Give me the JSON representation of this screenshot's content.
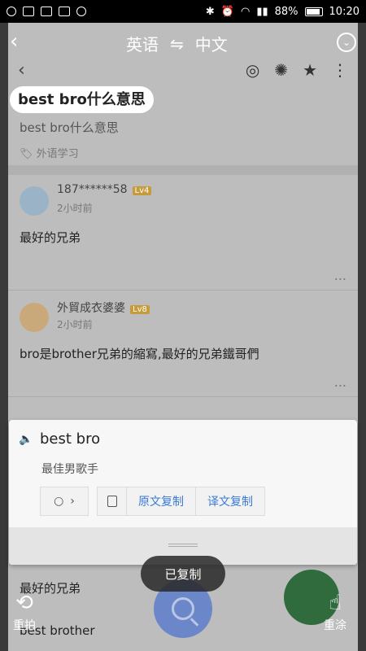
{
  "status_bar": {
    "battery": "88%",
    "time": "10:20"
  },
  "page": {
    "question_title": "best bro什么意思",
    "question_sub": "best bro什么意思",
    "tag": "外语学习",
    "answers": [
      {
        "user": "187******58",
        "level": "Lv4",
        "time": "2小时前",
        "text": "最好的兄弟",
        "more": "..."
      },
      {
        "user": "外貿成衣婆婆",
        "level": "Lv8",
        "time": "2小时前",
        "text": "bro是brother兄弟的縮寫,最好的兄弟鐵哥們",
        "more": "..."
      }
    ],
    "lower_lines": [
      "最好的兄弟",
      "best brother"
    ]
  },
  "translate_bar": {
    "source_lang": "英语",
    "swap_symbol": "⇋",
    "target_lang": "中文"
  },
  "popup": {
    "source_text": "best bro",
    "translation": "最佳男歌手",
    "copy_source_label": "原文复制",
    "copy_translation_label": "译文复制"
  },
  "toast": "已复制",
  "bottom": {
    "retake_label": "重拍",
    "repaint_label": "重涂"
  }
}
